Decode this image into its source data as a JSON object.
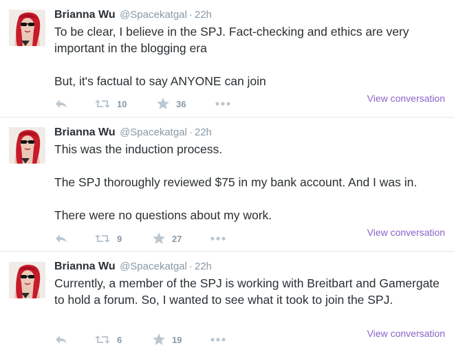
{
  "colors": {
    "link": "#8a62c9",
    "meta": "#8899a6",
    "text": "#292f33",
    "divider": "#e1e8ed"
  },
  "tweets": [
    {
      "name": "Brianna Wu",
      "handle": "@Spacekatgal",
      "separator": "·",
      "time": "22h",
      "paragraphs": [
        "To be clear, I believe in the SPJ. Fact-checking and ethics are very important in the blogging era",
        "But, it's factual to say ANYONE can join"
      ],
      "retweets": "10",
      "favorites": "36",
      "view_conversation": "View conversation"
    },
    {
      "name": "Brianna Wu",
      "handle": "@Spacekatgal",
      "separator": "·",
      "time": "22h",
      "paragraphs": [
        "This was the induction process.",
        "The SPJ thoroughly reviewed $75 in my bank account. And I was in.",
        "There were no questions about my work."
      ],
      "retweets": "9",
      "favorites": "27",
      "view_conversation": "View conversation"
    },
    {
      "name": "Brianna Wu",
      "handle": "@Spacekatgal",
      "separator": "·",
      "time": "22h",
      "paragraphs": [
        "Currently, a member of the SPJ is working with Breitbart and Gamergate to hold a forum. So, I wanted to see what it took to join the SPJ."
      ],
      "retweets": "6",
      "favorites": "19",
      "view_conversation": "View conversation"
    }
  ],
  "icons": {
    "reply": "reply-icon",
    "retweet": "retweet-icon",
    "favorite": "star-icon",
    "more": "more-options-icon"
  }
}
